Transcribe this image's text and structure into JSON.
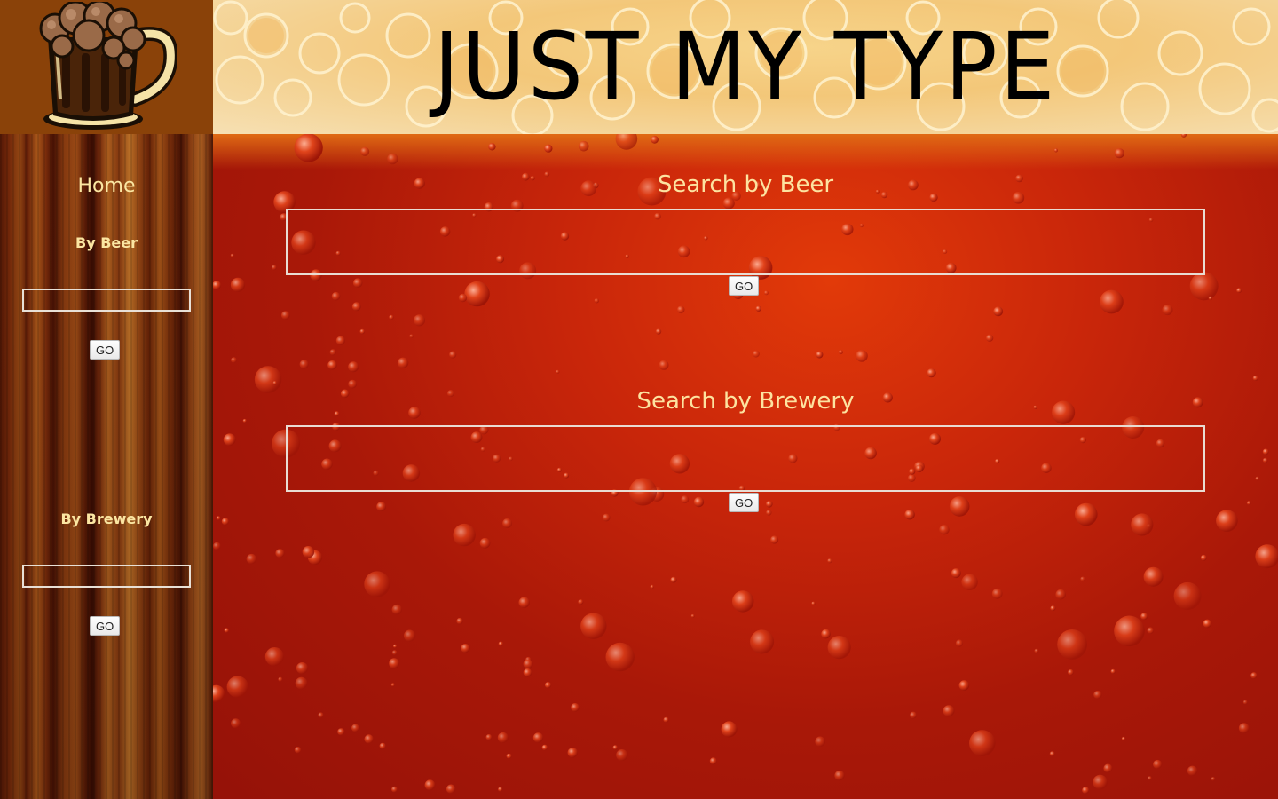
{
  "header": {
    "site_title": "JUST MY TYPE",
    "logo_icon": "beer-mug-icon"
  },
  "sidebar": {
    "home_label": "Home",
    "by_beer_label": "By Beer",
    "by_beer_input_value": "",
    "by_beer_go_label": "GO",
    "by_brewery_label": "By Brewery",
    "by_brewery_input_value": "",
    "by_brewery_go_label": "GO"
  },
  "main": {
    "beer_search": {
      "title": "Search by Beer",
      "input_value": "",
      "go_label": "GO"
    },
    "brewery_search": {
      "title": "Search by Brewery",
      "input_value": "",
      "go_label": "GO"
    }
  },
  "colors": {
    "logo_bg": "#8a4209",
    "heading_text": "#fde3a0",
    "beer_red": "#c9260a",
    "foam": "#f3c779"
  }
}
